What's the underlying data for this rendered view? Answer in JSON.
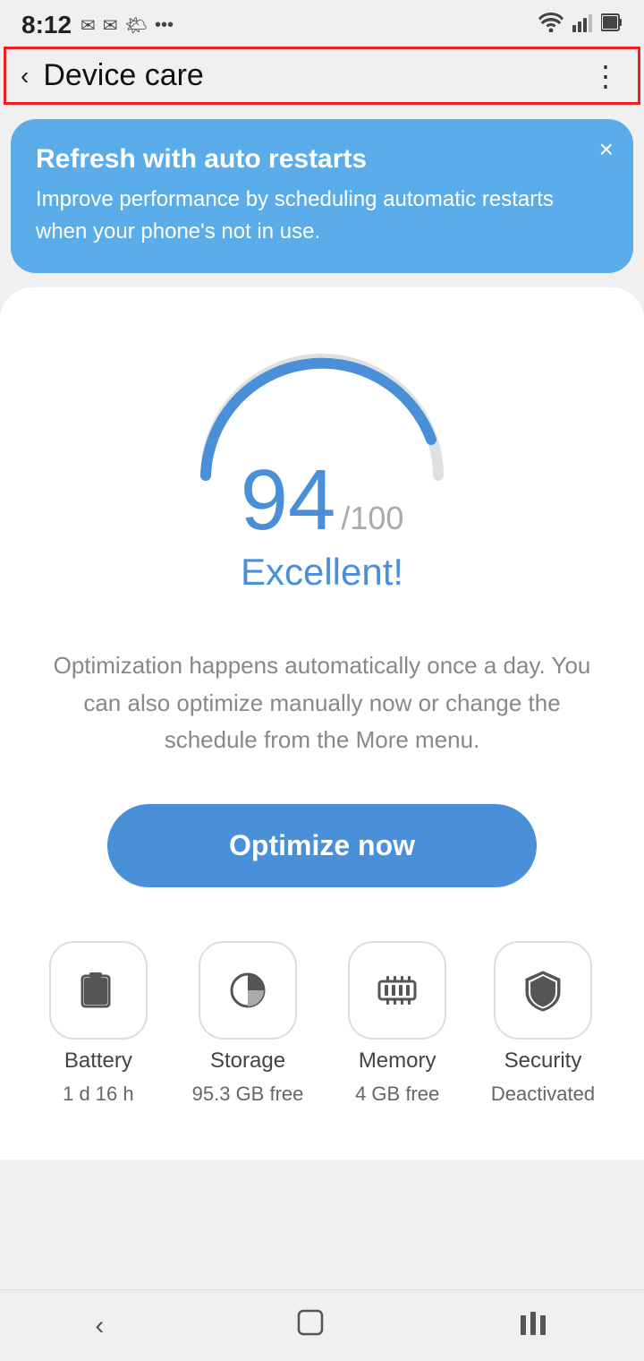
{
  "status_bar": {
    "time": "8:12",
    "left_icons": [
      "✉",
      "✉",
      "☀",
      "•••"
    ],
    "right_icons": [
      "wifi",
      "signal",
      "battery"
    ]
  },
  "header": {
    "back_label": "‹",
    "title": "Device care",
    "more_label": "⋮"
  },
  "banner": {
    "title": "Refresh with auto restarts",
    "description": "Improve performance by scheduling automatic restarts when your phone's not in use.",
    "close_label": "×"
  },
  "score": {
    "value": "94",
    "max": "/100",
    "label": "Excellent!"
  },
  "optimization_text": "Optimization happens automatically once a day. You can also optimize manually now or change the schedule from the More menu.",
  "optimize_button": "Optimize now",
  "grid": [
    {
      "id": "battery",
      "label": "Battery",
      "value": "1 d 16 h",
      "icon": "battery"
    },
    {
      "id": "storage",
      "label": "Storage",
      "value": "95.3 GB free",
      "icon": "storage"
    },
    {
      "id": "memory",
      "label": "Memory",
      "value": "4 GB free",
      "icon": "memory"
    },
    {
      "id": "security",
      "label": "Security",
      "value": "Deactivated",
      "icon": "security"
    }
  ],
  "bottom_nav": {
    "back": "‹",
    "home": "⬜",
    "recents": "|||"
  }
}
